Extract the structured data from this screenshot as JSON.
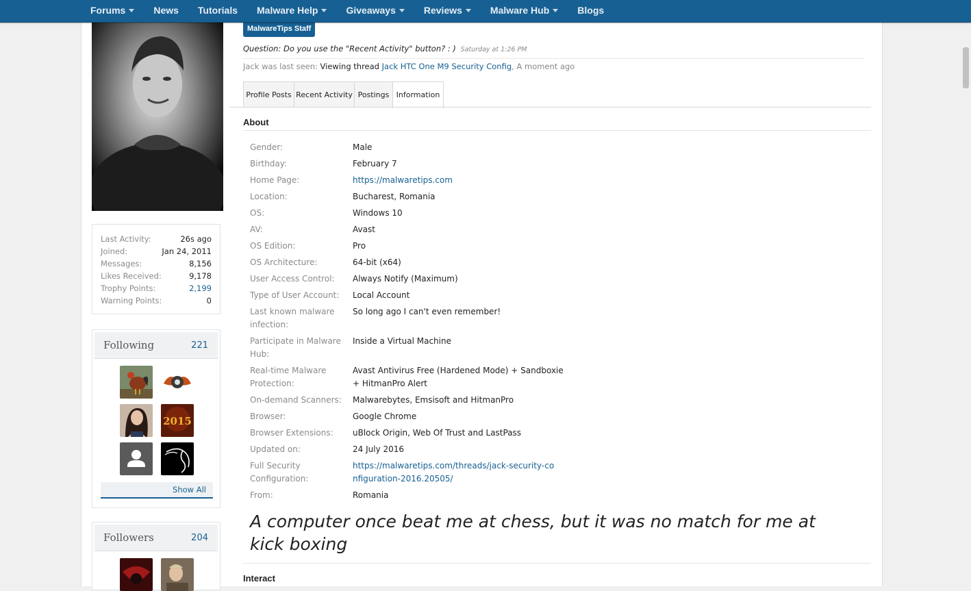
{
  "nav": {
    "items": [
      {
        "label": "Forums",
        "dropdown": true
      },
      {
        "label": "News",
        "dropdown": false
      },
      {
        "label": "Tutorials",
        "dropdown": false
      },
      {
        "label": "Malware Help",
        "dropdown": true
      },
      {
        "label": "Giveaways",
        "dropdown": true
      },
      {
        "label": "Reviews",
        "dropdown": true
      },
      {
        "label": "Malware Hub",
        "dropdown": true
      },
      {
        "label": "Blogs",
        "dropdown": false
      }
    ]
  },
  "sidebar": {
    "stats": [
      {
        "label": "Last Activity:",
        "value": "26s ago",
        "link": false
      },
      {
        "label": "Joined:",
        "value": "Jan 24, 2011",
        "link": false
      },
      {
        "label": "Messages:",
        "value": "8,156",
        "link": false
      },
      {
        "label": "Likes Received:",
        "value": "9,178",
        "link": false
      },
      {
        "label": "Trophy Points:",
        "value": "2,199",
        "link": true
      },
      {
        "label": "Warning Points:",
        "value": "0",
        "link": false
      }
    ],
    "following": {
      "title": "Following",
      "count": "221",
      "show_all": "Show All"
    },
    "followers": {
      "title": "Followers",
      "count": "204"
    }
  },
  "profile": {
    "badge": "MalwareTips Staff",
    "status_text": "Question: Do you use the \"Recent Activity\" button? : )",
    "status_time": "Saturday at 1:26 PM",
    "last_seen_label": "Jack was last seen:",
    "last_seen_action": "Viewing thread",
    "last_seen_thread": "Jack HTC One M9 Security Config",
    "last_seen_time": ", A moment ago"
  },
  "tabs": [
    {
      "label": "Profile Posts",
      "active": false
    },
    {
      "label": "Recent Activity",
      "active": false
    },
    {
      "label": "Postings",
      "active": false
    },
    {
      "label": "Information",
      "active": true
    }
  ],
  "about": {
    "heading": "About",
    "fields": [
      {
        "label": "Gender:",
        "value": "Male",
        "link": false
      },
      {
        "label": "Birthday:",
        "value": "February 7",
        "link": false
      },
      {
        "label": "Home Page:",
        "value": "https://malwaretips.com",
        "link": true
      },
      {
        "label": "Location:",
        "value": "Bucharest, Romania",
        "link": false
      },
      {
        "label": "OS:",
        "value": "Windows 10",
        "link": false
      },
      {
        "label": "AV:",
        "value": "Avast",
        "link": false
      },
      {
        "label": "OS Edition:",
        "value": "Pro",
        "link": false
      },
      {
        "label": "OS Architecture:",
        "value": "64-bit (x64)",
        "link": false
      },
      {
        "label": "User Access Control:",
        "value": "Always Notify (Maximum)",
        "link": false
      },
      {
        "label": "Type of User Account:",
        "value": "Local Account",
        "link": false
      },
      {
        "label": "Last known malware infection:",
        "value": "So long ago I can't even remember!",
        "link": false
      },
      {
        "label": "Participate in Malware Hub:",
        "value": "Inside a Virtual Machine",
        "link": false
      },
      {
        "label": "Real-time Malware Protection:",
        "value": "Avast Antivirus Free (Hardened Mode) + Sandboxie + HitmanPro Alert",
        "link": false
      },
      {
        "label": "On-demand Scanners:",
        "value": "Malwarebytes, Emsisoft and HitmanPro",
        "link": false
      },
      {
        "label": "Browser:",
        "value": "Google Chrome",
        "link": false
      },
      {
        "label": "Browser Extensions:",
        "value": "uBlock Origin, Web Of Trust and LastPass",
        "link": false
      },
      {
        "label": "Updated on:",
        "value": "24 July 2016",
        "link": false
      },
      {
        "label": "Full Security Configuration:",
        "value": "https://malwaretips.com/threads/jack-security-configuration-2016.20505/",
        "link": true
      },
      {
        "label": "From:",
        "value": "Romania",
        "link": false
      }
    ],
    "signature": "A computer once beat me at chess, but it was no match for me at kick boxing"
  },
  "interact": {
    "heading": "Interact"
  }
}
